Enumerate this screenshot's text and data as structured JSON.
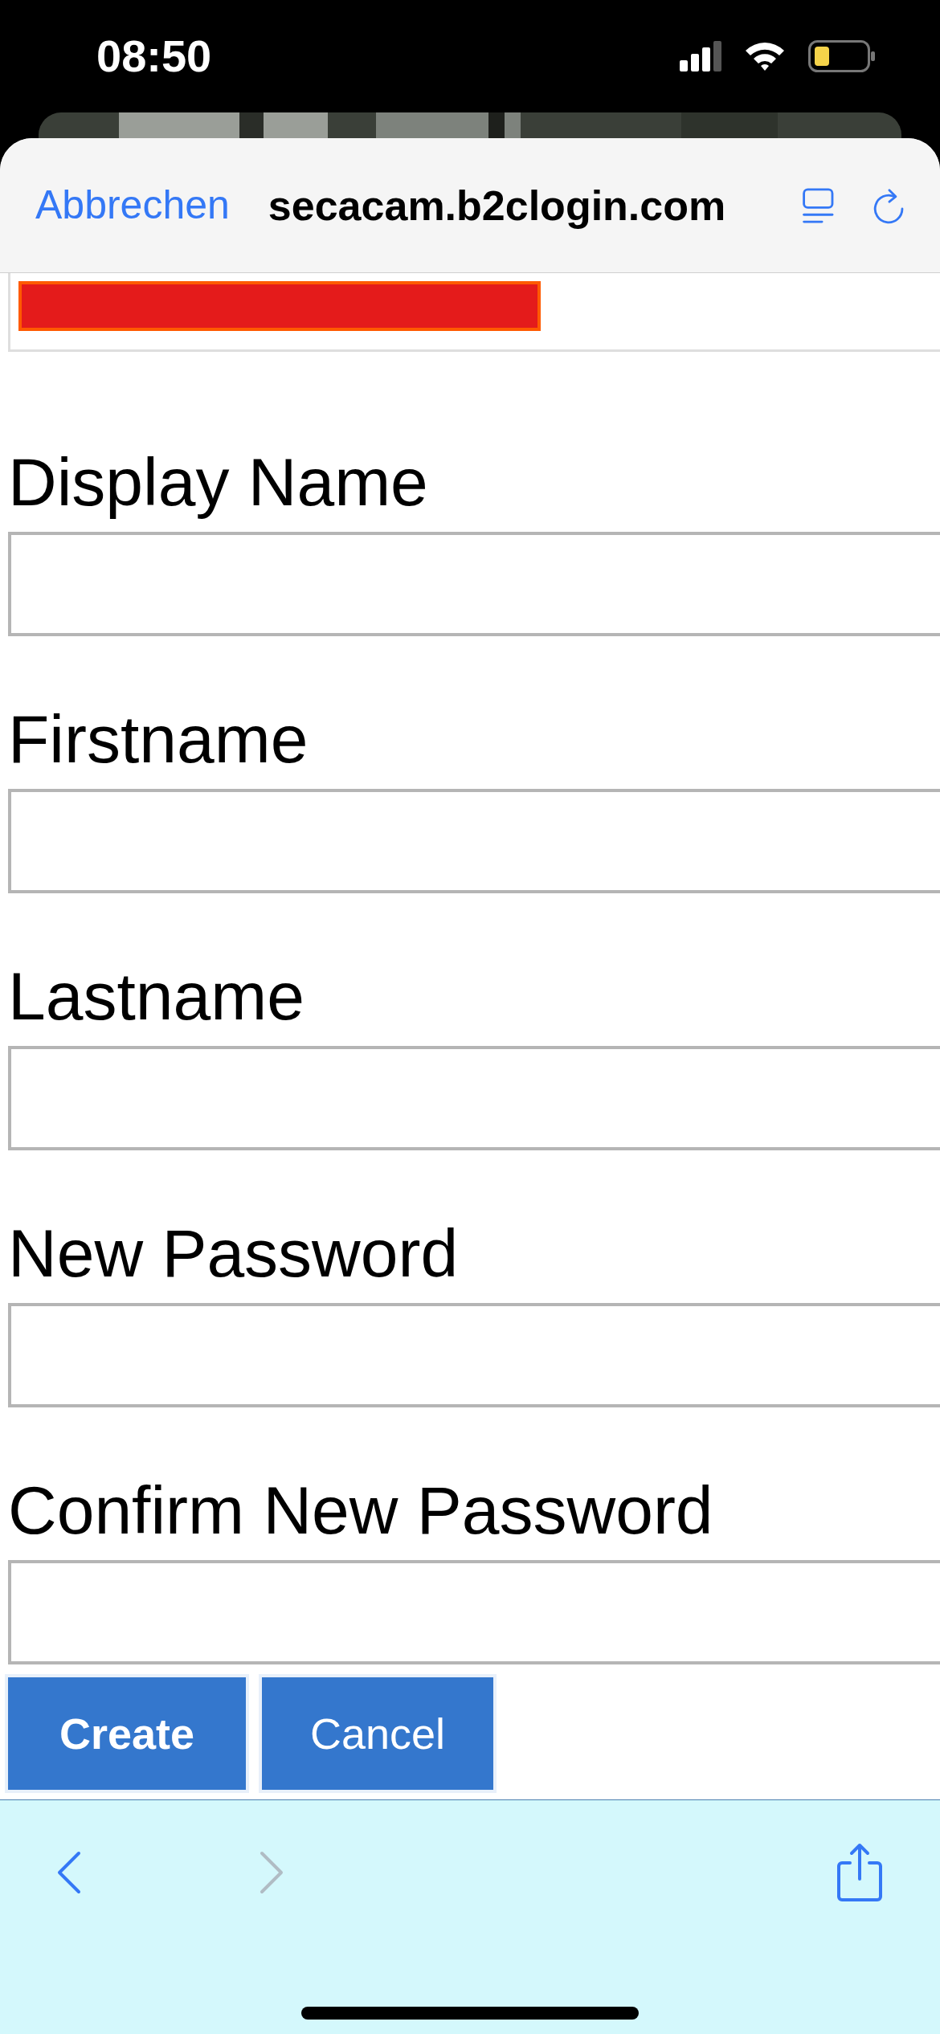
{
  "status_bar": {
    "time": "08:50"
  },
  "browser_header": {
    "cancel": "Abbrechen",
    "url": "secacam.b2clogin.com"
  },
  "fields": [
    {
      "label": "Display Name"
    },
    {
      "label": "Firstname"
    },
    {
      "label": "Lastname"
    },
    {
      "label": "New Password"
    },
    {
      "label": "Confirm New Password"
    }
  ],
  "buttons": [
    {
      "label": "Create",
      "kind": "primary"
    },
    {
      "label": "Cancel",
      "kind": "secondary"
    }
  ],
  "toolbar": {
    "back_disabled": false,
    "forward_disabled": true
  }
}
